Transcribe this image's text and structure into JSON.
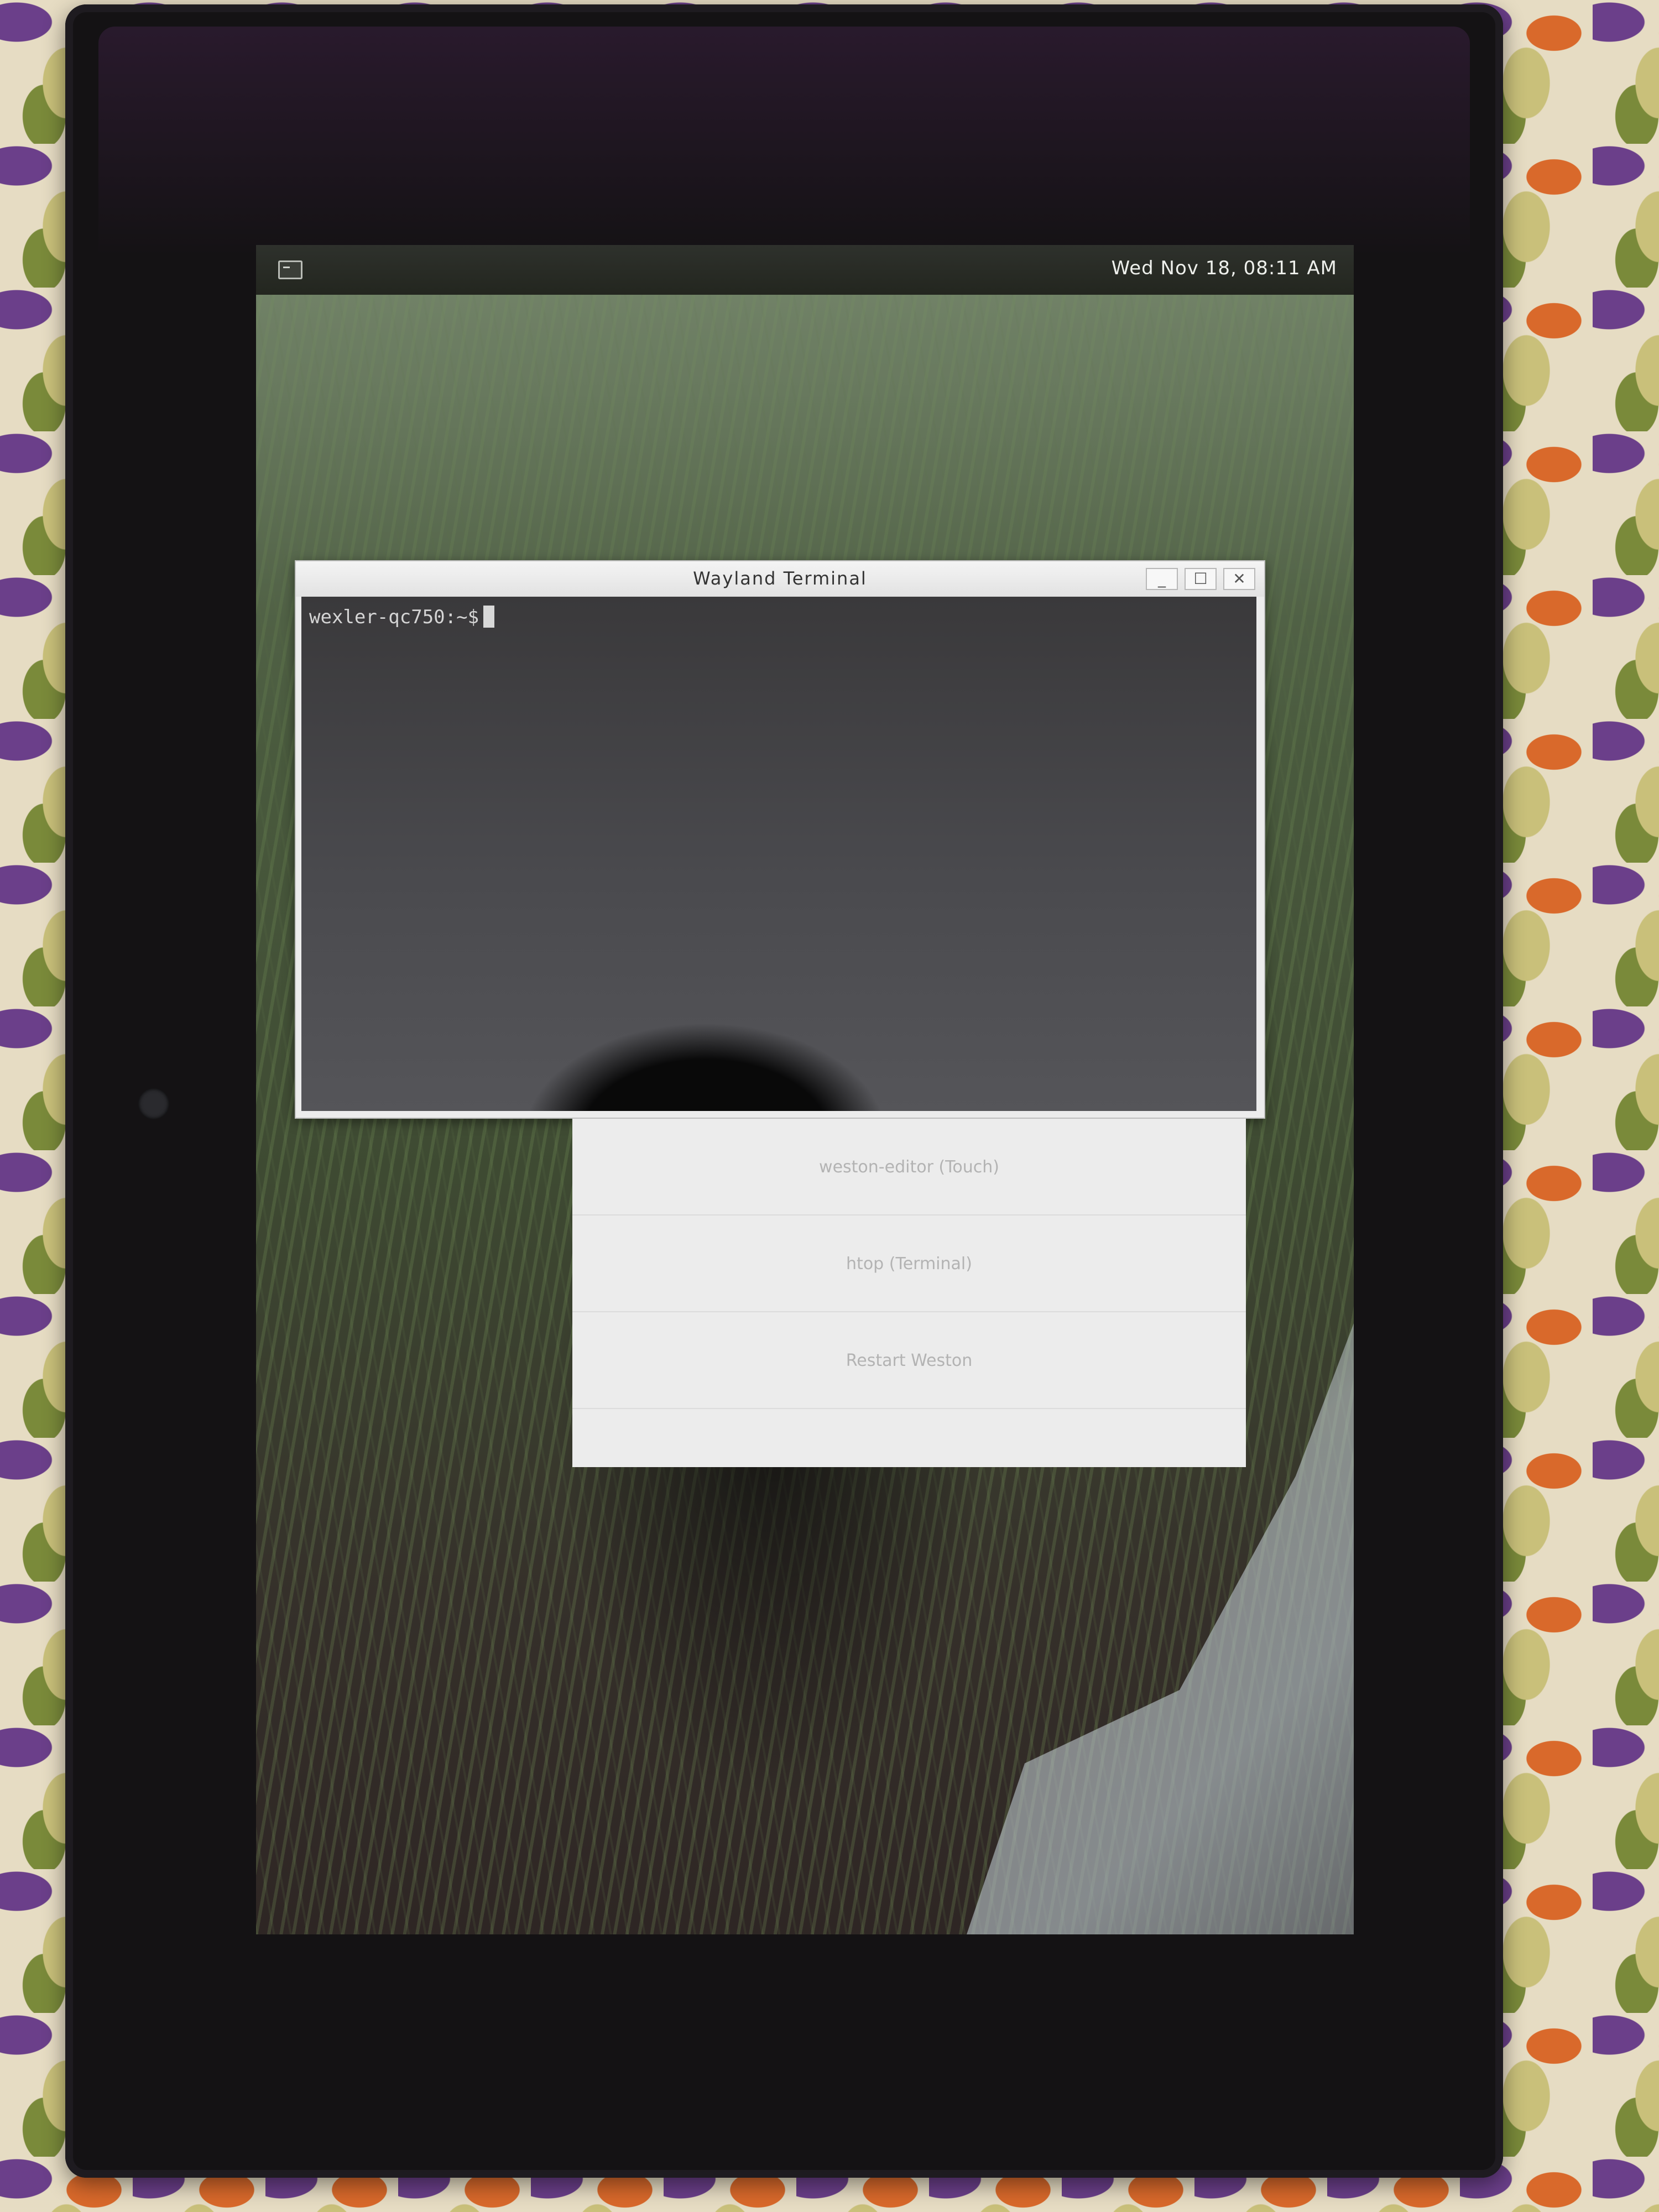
{
  "panel": {
    "clock": "Wed Nov 18, 08:11 AM",
    "launcher_icon": "terminal-launcher-icon"
  },
  "terminal": {
    "title": "Wayland Terminal",
    "prompt": "wexler-qc750:~$",
    "buttons": {
      "minimize": "_",
      "maximize": "☐",
      "close": "✕"
    }
  },
  "menu": {
    "items": [
      {
        "label": "weston-editor (Touch)"
      },
      {
        "label": "htop (Terminal)"
      },
      {
        "label": "Restart Weston"
      }
    ]
  }
}
